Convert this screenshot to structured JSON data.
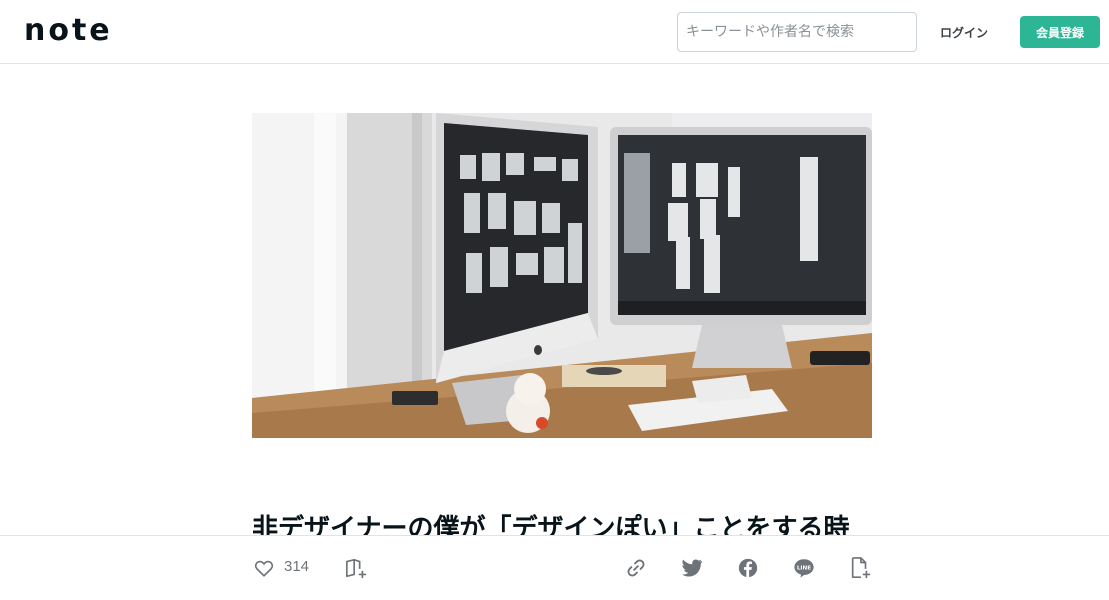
{
  "header": {
    "logo_text": "note",
    "search_placeholder": "キーワードや作者名で検索",
    "login_label": "ログイン",
    "signup_label": "会員登録",
    "accent_color": "#2cb696"
  },
  "article": {
    "title": "非デザイナーの僕が「デザインぽい」ことをする時"
  },
  "bottom_bar": {
    "like_count": "314",
    "icons": [
      "heart-icon",
      "magazine-add-icon",
      "link-icon",
      "twitter-icon",
      "facebook-icon",
      "line-icon",
      "note-add-icon"
    ]
  }
}
